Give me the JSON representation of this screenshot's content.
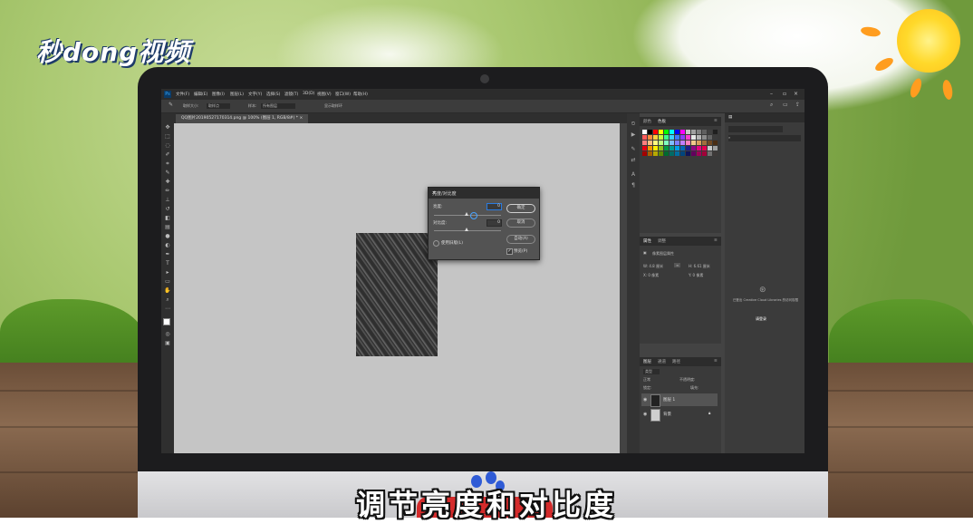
{
  "watermark": {
    "logo_text": "秒dong视频"
  },
  "subtitle": "调节亮度和对比度",
  "photoshop": {
    "app_icon": "Ps",
    "menu": [
      "文件(F)",
      "编辑(E)",
      "图像(I)",
      "图层(L)",
      "文字(Y)",
      "选择(S)",
      "滤镜(T)",
      "3D(D)",
      "视图(V)",
      "窗口(W)",
      "帮助(H)"
    ],
    "options": {
      "sample_size_label": "取样大小:",
      "sample_size_value": "取样点",
      "sample_label": "样本:",
      "sample_value": "所有图层",
      "show_ring": "显示取样环"
    },
    "document_tab": "QQ图片20190527170314.png @ 100% (图层 1, RGB/8#) *",
    "swatches_tabs": [
      "颜色",
      "色板"
    ],
    "properties_tabs": [
      "属性",
      "调整"
    ],
    "properties": {
      "title": "像素图层属性",
      "w": "W: 4.8 厘米",
      "h": "H: 6.61 厘米",
      "x": "X: 0 像素",
      "y": "Y: 0 像素"
    },
    "layers_tabs": [
      "图层",
      "通道",
      "路径"
    ],
    "layers_kind": "类型",
    "layers_blend": "正常",
    "layers_opacity": "不透明度:",
    "layers_lock": "锁定:",
    "layers_fill": "填充:",
    "layers": [
      {
        "name": "图层 1"
      },
      {
        "name": "背景"
      }
    ],
    "libraries": {
      "message": "已登出 Creative Cloud Libraries 的访问权限",
      "link": "请登录"
    }
  },
  "dialog": {
    "title": "亮度/对比度",
    "brightness_label": "亮度:",
    "brightness_value": "0",
    "contrast_label": "对比度:",
    "contrast_value": "0",
    "ok": "确定",
    "cancel": "取消",
    "auto": "自动(A)",
    "legacy": "使用旧版(L)",
    "preview": "预览(P)",
    "preview_checked": true
  },
  "swatch_colors": [
    "#ffffff",
    "#000000",
    "#ff0000",
    "#ffff00",
    "#00ff00",
    "#00ffff",
    "#0000ff",
    "#ff00ff",
    "#c8c8c8",
    "#a0a0a0",
    "#808080",
    "#606060",
    "#404040",
    "#202020",
    "#ff5a5a",
    "#ff8c3c",
    "#ffd03c",
    "#c8ff3c",
    "#3cff8c",
    "#3cd0ff",
    "#3c78ff",
    "#8c3cff",
    "#ff3cd0",
    "#e6e6e6",
    "#b4b4b4",
    "#8c8c8c",
    "#646464",
    "#3c3c3c",
    "#ff7f7f",
    "#ffbf7f",
    "#ffff7f",
    "#bfff7f",
    "#7fffbf",
    "#7fbfff",
    "#7f7fff",
    "#bf7fff",
    "#ff7fbf",
    "#f2c98a",
    "#d9a15c",
    "#a0703c",
    "#704a24",
    "#4a2e14",
    "#e60012",
    "#f39800",
    "#fff100",
    "#8fc31f",
    "#009944",
    "#009e96",
    "#00a0e9",
    "#0068b7",
    "#1d2088",
    "#920783",
    "#e4007f",
    "#e5004f",
    "#c9caca",
    "#9fa0a0",
    "#a40000",
    "#a85f00",
    "#b5a900",
    "#5f8a00",
    "#006a30",
    "#006b66",
    "#006da0",
    "#00457d",
    "#101558",
    "#63005e",
    "#9e0058",
    "#a30039",
    "#727171",
    "#3e3a39"
  ]
}
